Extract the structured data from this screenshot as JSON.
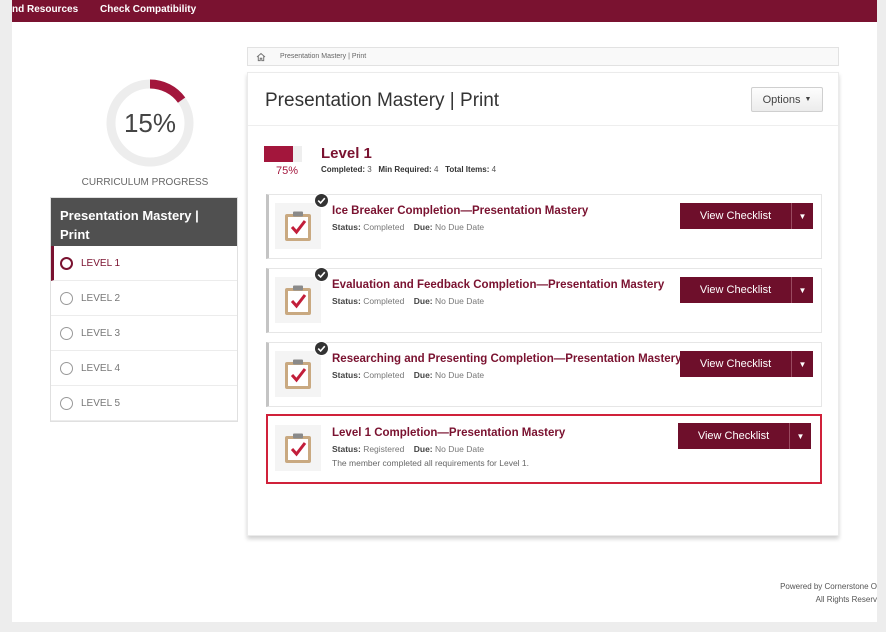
{
  "topnav": {
    "items": [
      "nd Resources",
      "Check Compatibility"
    ],
    "color": "#7a1230"
  },
  "progress": {
    "value": "15%",
    "fraction": 0.15,
    "label": "CURRICULUM PROGRESS",
    "accent": "#a3163c"
  },
  "curriculum": {
    "title": "Presentation Mastery | Print",
    "levels": [
      {
        "label": "LEVEL 1",
        "active": true
      },
      {
        "label": "LEVEL 2",
        "active": false
      },
      {
        "label": "LEVEL 3",
        "active": false
      },
      {
        "label": "LEVEL 4",
        "active": false
      },
      {
        "label": "LEVEL 5",
        "active": false
      }
    ]
  },
  "breadcrumb": {
    "icon": "home-icon",
    "text": "Presentation Mastery | Print"
  },
  "main": {
    "title": "Presentation Mastery | Print",
    "options_label": "Options"
  },
  "level": {
    "title": "Level 1",
    "percent": "75%",
    "fraction": 0.75,
    "completed_label": "Completed:",
    "completed_value": "3",
    "min_label": "Min Required:",
    "min_value": "4",
    "total_label": "Total Items:",
    "total_value": "4"
  },
  "items": [
    {
      "title": "Ice Breaker Completion—Presentation Mastery",
      "status_label": "Status:",
      "status": "Completed",
      "due_label": "Due:",
      "due": "No Due Date",
      "button": "View Checklist",
      "completed": true
    },
    {
      "title": "Evaluation and Feedback Completion—Presentation Mastery",
      "status_label": "Status:",
      "status": "Completed",
      "due_label": "Due:",
      "due": "No Due Date",
      "button": "View Checklist",
      "completed": true
    },
    {
      "title": "Researching and Presenting Completion—Presentation Mastery",
      "status_label": "Status:",
      "status": "Completed",
      "due_label": "Due:",
      "due": "No Due Date",
      "button": "View Checklist",
      "completed": true
    },
    {
      "title": "Level 1 Completion—Presentation Mastery",
      "status_label": "Status:",
      "status": "Registered",
      "due_label": "Due:",
      "due": "No Due Date",
      "note": "The member completed all requirements for Level 1.",
      "button": "View Checklist",
      "completed": false
    }
  ],
  "footer": {
    "line1": "Powered by Cornerstone O",
    "line2": "All Rights Reserv"
  }
}
